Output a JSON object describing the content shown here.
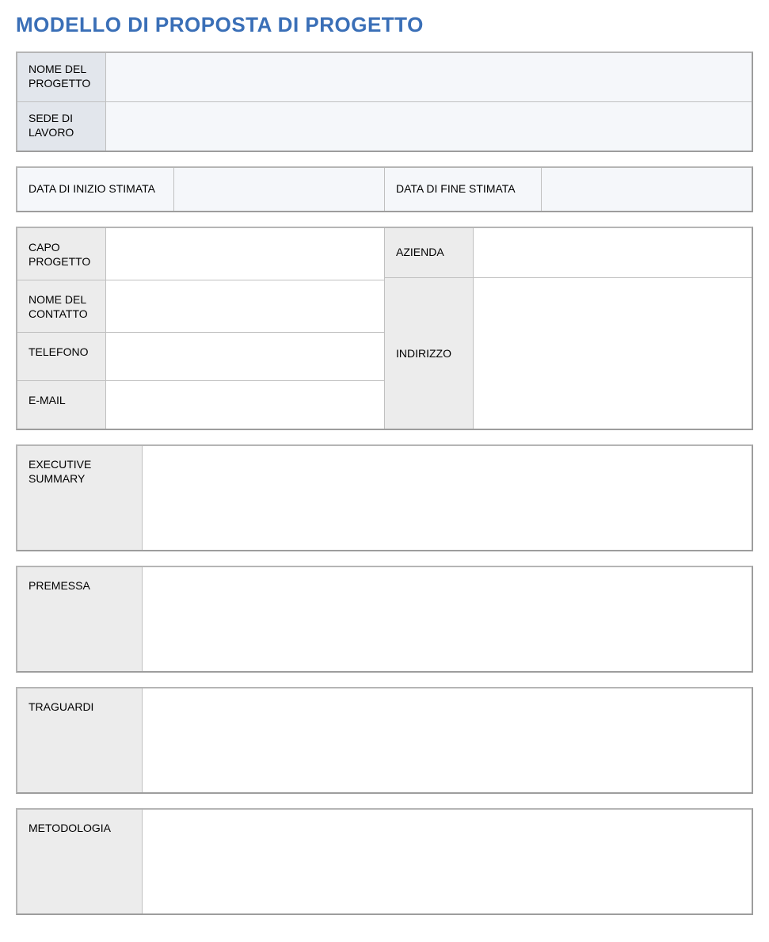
{
  "title": "MODELLO DI PROPOSTA DI PROGETTO",
  "header": {
    "project_name_label": "NOME DEL PROGETTO",
    "project_name_value": "",
    "worksite_label": "SEDE DI LAVORO",
    "worksite_value": ""
  },
  "dates": {
    "start_label": "DATA DI INIZIO STIMATA",
    "start_value": "",
    "end_label": "DATA DI FINE STIMATA",
    "end_value": ""
  },
  "contact": {
    "lead_label": "CAPO PROGETTO",
    "lead_value": "",
    "contact_name_label": "NOME DEL CONTATTO",
    "contact_name_value": "",
    "phone_label": "TELEFONO",
    "phone_value": "",
    "email_label": "E-MAIL",
    "email_value": "",
    "company_label": "AZIENDA",
    "company_value": "",
    "address_label": "INDIRIZZO",
    "address_value": ""
  },
  "sections": {
    "exec_summary_label": "EXECUTIVE SUMMARY",
    "exec_summary_value": "",
    "premise_label": "PREMESSA",
    "premise_value": "",
    "goals_label": "TRAGUARDI",
    "goals_value": "",
    "methodology_label": "METODOLOGIA",
    "methodology_value": ""
  }
}
